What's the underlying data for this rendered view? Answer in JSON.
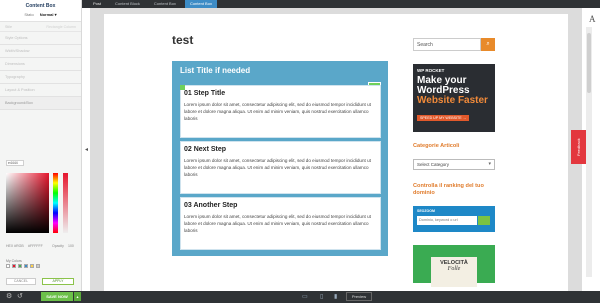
{
  "panel": {
    "title": "Content Box",
    "tab_state": "Stato",
    "tab_normal": "Normal ▾",
    "rows": [
      {
        "label": "Stile",
        "value": "Rectangle Column"
      },
      {
        "label": "",
        "value": ""
      }
    ],
    "sections": [
      "Style Options",
      "Width/Shadow",
      "Dimensions",
      "Typography",
      "Layout & Position",
      "Background/Box"
    ],
    "hex_value": "e4444",
    "color_values": [
      "HEX #RGB",
      "#FFFFFF",
      "Opacity",
      "100"
    ],
    "my_colors_label": "My Colors",
    "swatches": [
      "#ffffff",
      "#e6162d",
      "#4caf50",
      "#3d8cc6",
      "#ffd24a",
      "#cccccc"
    ],
    "cancel_label": "CANCEL",
    "apply_label": "APPLY"
  },
  "topbar": {
    "crumbs": [
      "Post",
      "Content Block",
      "Content Box",
      "Content Box"
    ]
  },
  "page": {
    "title": "test",
    "box_title": "List Title if needed",
    "steps": [
      {
        "title": "01 Step Title",
        "text": "Lorem ipsum dolor sit amet, consectetur adipiscing elit, sed do eiusmod tempor incididunt ut labore et dolore magna aliqua. Ut enim ad minim veniam, quis nostrud exercitation ullamco laboris"
      },
      {
        "title": "02 Next Step",
        "text": "Lorem ipsum dolor sit amet, consectetur adipiscing elit, sed do eiusmod tempor incididunt ut labore et dolore magna aliqua. Ut enim ad minim veniam, quis nostrud exercitation ullamco laboris"
      },
      {
        "title": "03 Another Step",
        "text": "Lorem ipsum dolor sit amet, consectetur adipiscing elit, sed do eiusmod tempor incididunt ut labore et dolore magna aliqua. Ut enim ad minim veniam, quis nostrud exercitation ullamco laboris"
      }
    ],
    "feedback_label": "Feedback"
  },
  "sidebar": {
    "search_placeholder": "Search",
    "ad": {
      "brand": "WP ROCKET",
      "line1": "Make your",
      "line2": "WordPress",
      "line3": "Website Faster",
      "cta": "SPEED UP MY WEBSITE →"
    },
    "categories_title": "Categorie Articoli",
    "select_value": "Select Category",
    "ranking_title": "Controlla il ranking del tuo dominio",
    "seo_logo": "SEOZOOM",
    "seo_placeholder": "Dominio, keyword o url",
    "book_t1": "VELOCITÀ",
    "book_t2": "Folle"
  },
  "bottombar": {
    "save_label": "SAVE NOW",
    "preview_label": "Preview"
  },
  "colors": {
    "accent": "#3d8cc6",
    "box_bg": "#5aa7c9",
    "save": "#6cc04a",
    "widget_title": "#e07b2b"
  }
}
